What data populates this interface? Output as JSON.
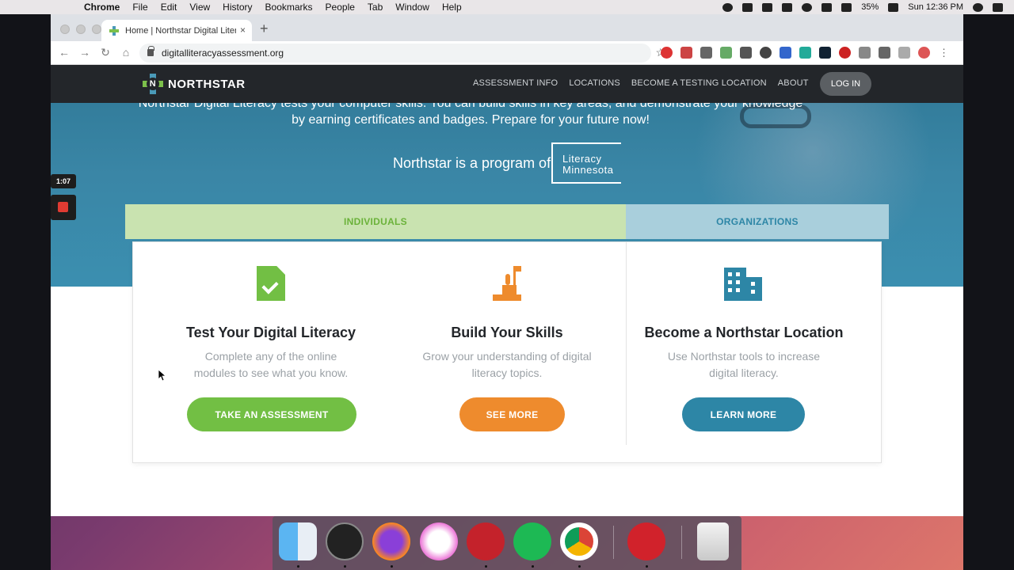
{
  "menubar": {
    "apple": "",
    "items": [
      "Chrome",
      "File",
      "Edit",
      "View",
      "History",
      "Bookmarks",
      "People",
      "Tab",
      "Window",
      "Help"
    ],
    "battery": "35%",
    "clock": "Sun 12:36 PM"
  },
  "browser": {
    "tab_title": "Home | Northstar Digital Litera",
    "tab_close": "×",
    "new_tab": "+",
    "url": "digitalliteracyassessment.org"
  },
  "site": {
    "brand": "NORTHSTAR",
    "brand_mark_letter": "N",
    "nav": [
      "ASSESSMENT INFO",
      "LOCATIONS",
      "BECOME A TESTING LOCATION",
      "ABOUT"
    ],
    "login": "LOG IN",
    "hero_text": "Northstar Digital Literacy tests your computer skills. You can build skills in key areas, and demonstrate your knowledge by earning certificates and badges. Prepare for your future now!",
    "program_text": "Northstar is a program of",
    "partner_logo_line1": "Literacy",
    "partner_logo_line2": "Minnesota",
    "segments": {
      "individuals": "INDIVIDUALS",
      "organizations": "ORGANIZATIONS"
    },
    "columns": [
      {
        "heading": "Test Your Digital Literacy",
        "desc": "Complete any of the online modules to see what you know.",
        "button": "TAKE AN ASSESSMENT",
        "icon": "document-check-icon"
      },
      {
        "heading": "Build Your Skills",
        "desc": "Grow your understanding of digital literacy topics.",
        "button": "SEE MORE",
        "icon": "climb-flag-icon"
      },
      {
        "heading": "Become a Northstar Location",
        "desc": "Use Northstar tools to increase digital literacy.",
        "button": "LEARN MORE",
        "icon": "building-icon"
      }
    ]
  },
  "recorder": {
    "time": "1:07"
  },
  "colors": {
    "green": "#72bf44",
    "orange": "#ee8b2d",
    "blue": "#2d86a6",
    "navbar": "#23262a"
  },
  "dock": [
    "finder-icon",
    "dashboard-icon",
    "firefox-icon",
    "itunes-icon",
    "lastfm-icon",
    "spotify-icon",
    "chrome-icon",
    "expressvpn-icon",
    "trash-icon"
  ]
}
